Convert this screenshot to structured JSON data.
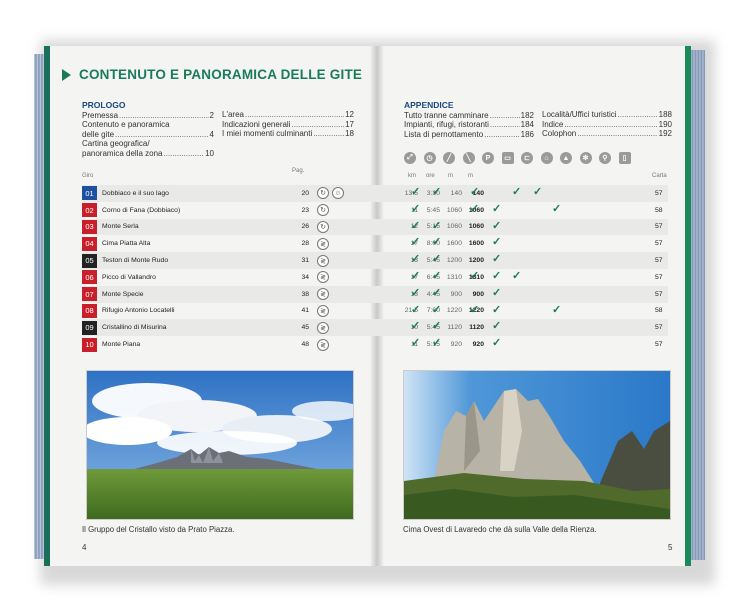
{
  "title": "CONTENUTO E PANORAMICA DELLE GITE",
  "prologo": {
    "head": "PROLOGO",
    "col1": [
      {
        "label": "Premessa",
        "page": "2"
      },
      {
        "label": "Contenuto e panoramica",
        "page": ""
      },
      {
        "label": "delle gite",
        "page": "4"
      },
      {
        "label": "Cartina geografica/",
        "page": ""
      },
      {
        "label": "panoramica della zona",
        "page": "10"
      }
    ],
    "col2": [
      {
        "label": "L'area",
        "page": "12"
      },
      {
        "label": "Indicazioni generali",
        "page": "17"
      },
      {
        "label": "I miei momenti culminanti",
        "page": "18"
      }
    ]
  },
  "appendice": {
    "head": "APPENDICE",
    "col1": [
      {
        "label": "Tutto tranne camminare",
        "page": "182"
      },
      {
        "label": "Impianti, rifugi, ristoranti",
        "page": "184"
      },
      {
        "label": "Lista di pernottamento",
        "page": "186"
      }
    ],
    "col2": [
      {
        "label": "Località/Uffici turistici",
        "page": "188"
      },
      {
        "label": "Indice",
        "page": "190"
      },
      {
        "label": "Colophon",
        "page": "192"
      }
    ]
  },
  "headers": {
    "giro": "Giro",
    "pag": "Pag.",
    "km": "km",
    "ore": "ore",
    "m1": "m",
    "m2": "m",
    "carta": "Carta"
  },
  "check_glyph": "✓",
  "tours": [
    {
      "n": "01",
      "color": "#1f4fa0",
      "name": "Dobbiaco e il suo lago",
      "pag": "20",
      "icons": [
        "↻",
        "☺"
      ],
      "km": "13.5",
      "ore": "3:30",
      "m1": "140",
      "m2": "140",
      "checks": [
        1,
        1,
        0,
        1,
        0,
        1,
        1,
        0
      ],
      "carta": "57"
    },
    {
      "n": "02",
      "color": "#c8202a",
      "name": "Corno di Fana (Dobbiaco)",
      "pag": "23",
      "icons": [
        "↻"
      ],
      "km": "11",
      "ore": "5:45",
      "m1": "1060",
      "m2": "1060",
      "checks": [
        1,
        0,
        0,
        1,
        1,
        0,
        0,
        1
      ],
      "carta": "58"
    },
    {
      "n": "03",
      "color": "#c8202a",
      "name": "Monte Serla",
      "pag": "26",
      "icons": [
        "↻"
      ],
      "km": "12",
      "ore": "5:15",
      "m1": "1060",
      "m2": "1060",
      "checks": [
        1,
        1,
        0,
        0,
        1,
        0,
        0,
        0
      ],
      "carta": "57"
    },
    {
      "n": "04",
      "color": "#c8202a",
      "name": "Cima Piatta Alta",
      "pag": "28",
      "icons": [
        "≷"
      ],
      "km": "17",
      "ore": "8:00",
      "m1": "1600",
      "m2": "1600",
      "checks": [
        1,
        1,
        0,
        0,
        1,
        0,
        0,
        0
      ],
      "carta": "57"
    },
    {
      "n": "05",
      "color": "#222222",
      "name": "Teston di Monte Rudo",
      "pag": "31",
      "icons": [
        "≷"
      ],
      "km": "13",
      "ore": "5:45",
      "m1": "1200",
      "m2": "1200",
      "checks": [
        1,
        1,
        0,
        0,
        1,
        0,
        0,
        0
      ],
      "carta": "57"
    },
    {
      "n": "06",
      "color": "#c8202a",
      "name": "Picco di Vallandro",
      "pag": "34",
      "icons": [
        "≷"
      ],
      "km": "17",
      "ore": "6:45",
      "m1": "1310",
      "m2": "1310",
      "checks": [
        1,
        1,
        0,
        1,
        1,
        1,
        0,
        0
      ],
      "carta": "57"
    },
    {
      "n": "07",
      "color": "#c8202a",
      "name": "Monte Specie",
      "pag": "38",
      "icons": [
        "≷"
      ],
      "km": "13",
      "ore": "4:45",
      "m1": "900",
      "m2": "900",
      "checks": [
        1,
        1,
        0,
        0,
        1,
        0,
        0,
        0
      ],
      "carta": "57"
    },
    {
      "n": "08",
      "color": "#c8202a",
      "name": "Rifugio Antonio Locatelli",
      "pag": "41",
      "icons": [
        "≷"
      ],
      "km": "21.5",
      "ore": "7:00",
      "m1": "1220",
      "m2": "1220",
      "checks": [
        1,
        1,
        0,
        1,
        1,
        0,
        0,
        1
      ],
      "carta": "58"
    },
    {
      "n": "09",
      "color": "#222222",
      "name": "Cristallino di Misurina",
      "pag": "45",
      "icons": [
        "≷"
      ],
      "km": "10",
      "ore": "5:45",
      "m1": "1120",
      "m2": "1120",
      "checks": [
        1,
        1,
        0,
        0,
        1,
        0,
        0,
        0
      ],
      "carta": "57"
    },
    {
      "n": "10",
      "color": "#c8202a",
      "name": "Monte Piana",
      "pag": "48",
      "icons": [
        "≷"
      ],
      "km": "11",
      "ore": "5:15",
      "m1": "920",
      "m2": "920",
      "checks": [
        1,
        1,
        0,
        0,
        1,
        0,
        0,
        0
      ],
      "carta": "57"
    }
  ],
  "captions": {
    "left": "Il Gruppo del Cristallo visto da Prato Piazza.",
    "right": "Cima Ovest di Lavaredo che dà sulla Valle della Rienza."
  },
  "page_numbers": {
    "left": "4",
    "right": "5"
  },
  "header_icons": [
    "signpost-icon",
    "clock-icon",
    "slope-icon",
    "descent-icon",
    "parking-icon",
    "bus-icon",
    "cable-car-icon",
    "restaurant-icon",
    "hut-icon",
    "snowflake-icon",
    "bike-icon",
    "phone-icon"
  ]
}
